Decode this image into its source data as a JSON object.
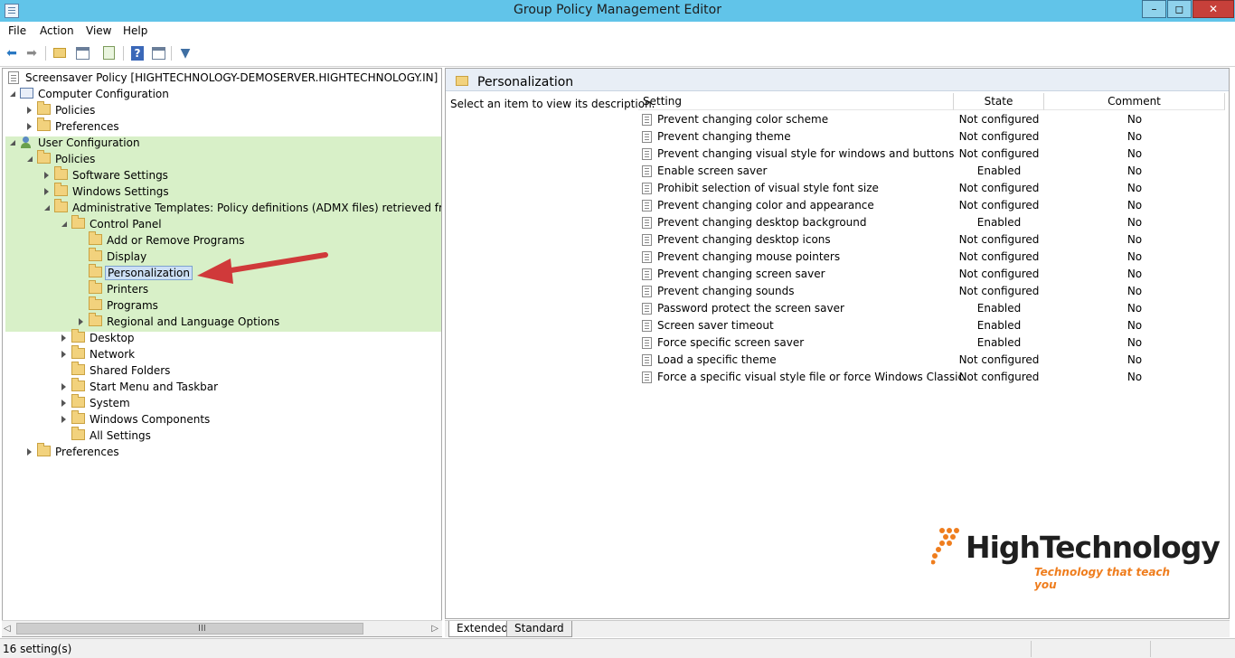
{
  "window": {
    "title": "Group Policy Management Editor",
    "controls": {
      "minimize": "–",
      "maximize": "◻",
      "close": "✕"
    }
  },
  "menu": [
    "File",
    "Action",
    "View",
    "Help"
  ],
  "toolbar": {
    "icons": [
      "back-icon",
      "forward-icon",
      "up-folder-icon",
      "show-hide-tree-icon",
      "export-list-icon",
      "help-icon",
      "properties-icon",
      "filter-icon"
    ]
  },
  "tree": {
    "root": "Screensaver Policy [HIGHTECHNOLOGY-DEMOSERVER.HIGHTECHNOLOGY.IN] Policy",
    "computer_configuration": "Computer Configuration",
    "cc_policies": "Policies",
    "cc_preferences": "Preferences",
    "user_configuration": "User Configuration",
    "uc_policies": "Policies",
    "software_settings": "Software Settings",
    "windows_settings": "Windows Settings",
    "administrative_templates": "Administrative Templates: Policy definitions (ADMX files) retrieved from the",
    "control_panel": "Control Panel",
    "add_remove_programs": "Add or Remove Programs",
    "display": "Display",
    "personalization": "Personalization",
    "printers": "Printers",
    "programs": "Programs",
    "regional_language": "Regional and Language Options",
    "desktop": "Desktop",
    "network": "Network",
    "shared_folders": "Shared Folders",
    "start_menu": "Start Menu and Taskbar",
    "system": "System",
    "windows_components": "Windows Components",
    "all_settings": "All Settings",
    "uc_preferences": "Preferences",
    "hscroll_grip": "III",
    "hscroll_left": "◁",
    "hscroll_right": "▷"
  },
  "details": {
    "title": "Personalization",
    "description": "Select an item to view its description.",
    "columns": {
      "setting": "Setting",
      "state": "State",
      "comment": "Comment"
    },
    "rows": [
      {
        "setting": "Prevent changing color scheme",
        "state": "Not configured",
        "comment": "No"
      },
      {
        "setting": "Prevent changing theme",
        "state": "Not configured",
        "comment": "No"
      },
      {
        "setting": "Prevent changing visual style for windows and buttons",
        "state": "Not configured",
        "comment": "No"
      },
      {
        "setting": "Enable screen saver",
        "state": "Enabled",
        "comment": "No"
      },
      {
        "setting": "Prohibit selection of visual style font size",
        "state": "Not configured",
        "comment": "No"
      },
      {
        "setting": "Prevent changing color and appearance",
        "state": "Not configured",
        "comment": "No"
      },
      {
        "setting": "Prevent changing desktop background",
        "state": "Enabled",
        "comment": "No"
      },
      {
        "setting": "Prevent changing desktop icons",
        "state": "Not configured",
        "comment": "No"
      },
      {
        "setting": "Prevent changing mouse pointers",
        "state": "Not configured",
        "comment": "No"
      },
      {
        "setting": "Prevent changing screen saver",
        "state": "Not configured",
        "comment": "No"
      },
      {
        "setting": "Prevent changing sounds",
        "state": "Not configured",
        "comment": "No"
      },
      {
        "setting": "Password protect the screen saver",
        "state": "Enabled",
        "comment": "No"
      },
      {
        "setting": "Screen saver timeout",
        "state": "Enabled",
        "comment": "No"
      },
      {
        "setting": "Force specific screen saver",
        "state": "Enabled",
        "comment": "No"
      },
      {
        "setting": "Load a specific theme",
        "state": "Not configured",
        "comment": "No"
      },
      {
        "setting": "Force a specific visual style file or force Windows Classic",
        "state": "Not configured",
        "comment": "No"
      }
    ]
  },
  "tabs": {
    "extended": "Extended",
    "standard": "Standard"
  },
  "watermark": {
    "name": "HighTechnology",
    "tagline": "Technology that teach you"
  },
  "status": "16 setting(s)",
  "colors": {
    "titlebar": "#61c4e9",
    "highlight": "#d8f0c8",
    "arrow": "#d0393a",
    "brand_orange": "#ef7d1d"
  }
}
